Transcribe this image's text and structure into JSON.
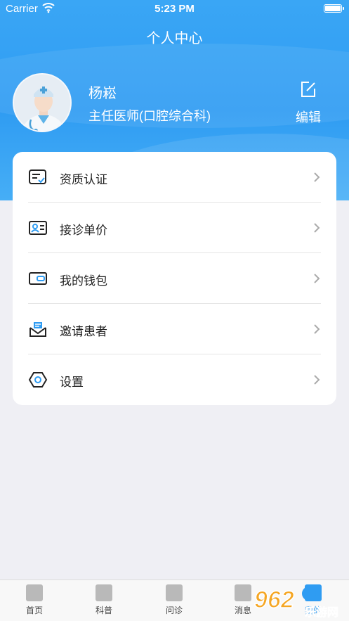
{
  "status_bar": {
    "carrier": "Carrier",
    "time": "5:23 PM"
  },
  "header": {
    "title": "个人中心"
  },
  "profile": {
    "name": "杨崧",
    "title": "主任医师(口腔综合科)",
    "edit_label": "编辑"
  },
  "menu": {
    "items": [
      {
        "label": "资质认证",
        "icon": "certificate-icon"
      },
      {
        "label": "接诊单价",
        "icon": "id-card-icon"
      },
      {
        "label": "我的钱包",
        "icon": "wallet-icon"
      },
      {
        "label": "邀请患者",
        "icon": "invite-envelope-icon"
      },
      {
        "label": "设置",
        "icon": "settings-hexagon-icon"
      }
    ]
  },
  "tabbar": {
    "tabs": [
      {
        "label": "首页",
        "icon": "home-icon"
      },
      {
        "label": "科普",
        "icon": "document-icon"
      },
      {
        "label": "问诊",
        "icon": "plus-square-icon"
      },
      {
        "label": "消息",
        "icon": "message-icon"
      },
      {
        "label": "我的",
        "icon": "profile-icon"
      }
    ]
  },
  "watermark": {
    "text": "962.net 乐游网"
  },
  "colors": {
    "header_blue": "#2f9cf2",
    "accent_icon_blue": "#2f9cf2",
    "background": "#efeff4"
  }
}
